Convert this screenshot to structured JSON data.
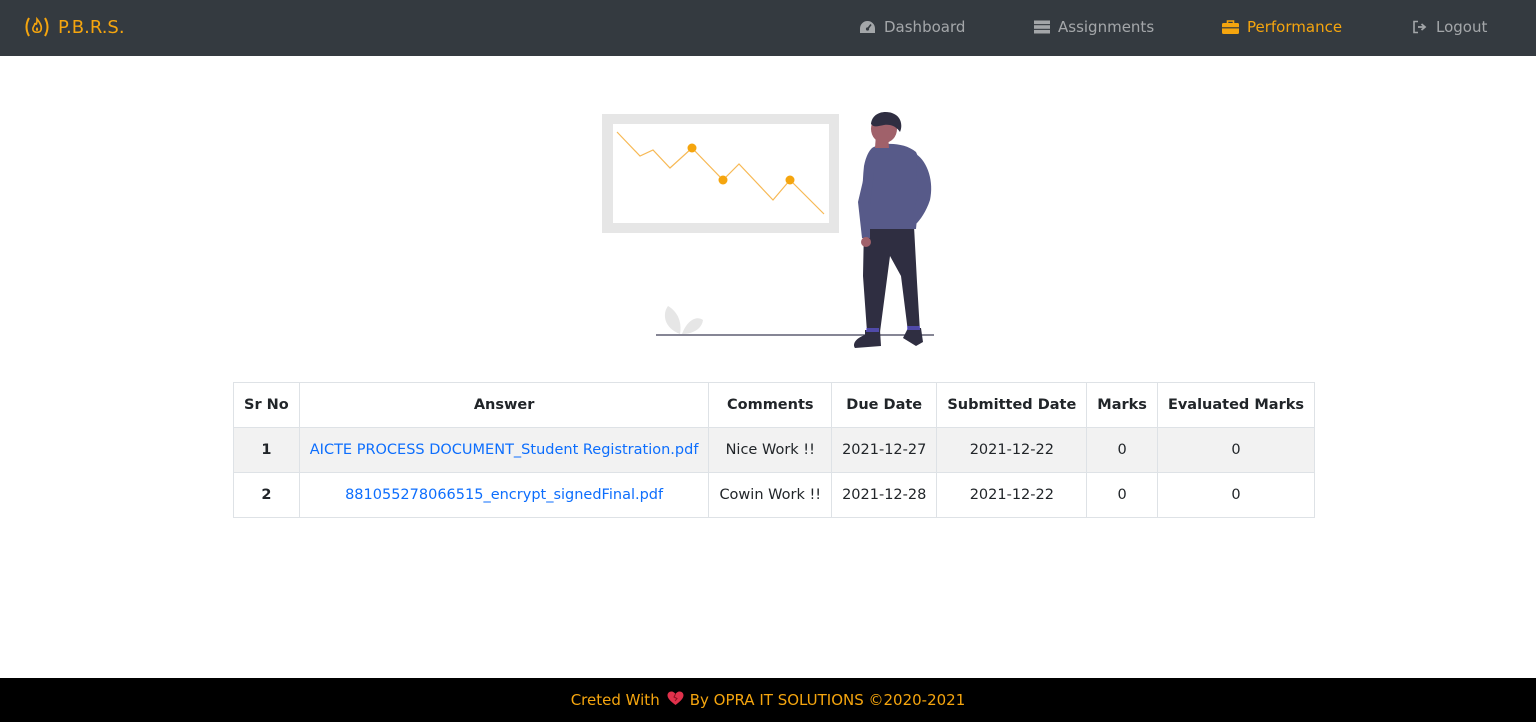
{
  "brand": {
    "name": "P.B.R.S.",
    "icon": "fire-icon"
  },
  "nav": {
    "items": [
      {
        "label": "Dashboard",
        "icon": "tachometer-icon",
        "active": false
      },
      {
        "label": "Assignments",
        "icon": "server-icon",
        "active": false
      },
      {
        "label": "Performance",
        "icon": "briefcase-icon",
        "active": true
      },
      {
        "label": "Logout",
        "icon": "sign-out-icon",
        "active": false
      }
    ]
  },
  "colors": {
    "navbar_bg": "#343a40",
    "accent": "#f5a50e",
    "nav_inactive": "rgba(255,255,255,0.55)",
    "link": "#0d6efd",
    "footer_bg": "#000000"
  },
  "table": {
    "headers": [
      "Sr No",
      "Answer",
      "Comments",
      "Due Date",
      "Submitted Date",
      "Marks",
      "Evaluated Marks"
    ],
    "rows": [
      {
        "sr": "1",
        "answer": "AICTE PROCESS DOCUMENT_Student Registration.pdf",
        "comments": "Nice Work !!",
        "due": "2021-12-27",
        "submitted": "2021-12-22",
        "marks": "0",
        "evaluated": "0"
      },
      {
        "sr": "2",
        "answer": "881055278066515_encrypt_signedFinal.pdf",
        "comments": "Cowin Work !!",
        "due": "2021-12-28",
        "submitted": "2021-12-22",
        "marks": "0",
        "evaluated": "0"
      }
    ]
  },
  "footer": {
    "prefix": "Creted With",
    "icon": "heart-icon",
    "suffix": "By OPRA IT SOLUTIONS ©2020-2021"
  }
}
